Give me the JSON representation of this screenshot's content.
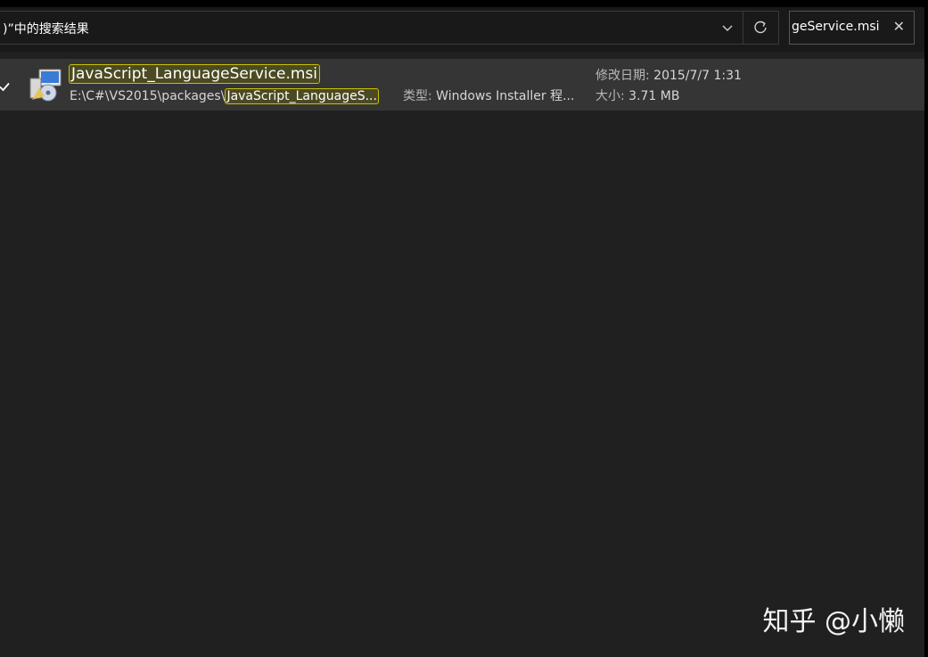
{
  "address": {
    "text": ")”中的搜索结果"
  },
  "search": {
    "value": "geService.msi"
  },
  "results": [
    {
      "name": "JavaScript_LanguageService.msi",
      "path_prefix": "E:\\C#\\VS2015\\packages\\",
      "path_highlight": "JavaScript_LanguageS...",
      "type_label": "类型:",
      "type_value": "Windows Installer 程...",
      "date_label": "修改日期:",
      "date_value": "2015/7/7 1:31",
      "size_label": "大小:",
      "size_value": "3.71 MB",
      "checked": true
    }
  ],
  "watermark": "知乎 @小懒",
  "colors": {
    "background": "#202020",
    "row_selected": "#353535",
    "highlight_border": "#c9c000"
  },
  "icons": {
    "dropdown": "chevron-down-icon",
    "refresh": "refresh-icon",
    "clear": "close-icon",
    "file": "msi-installer-icon",
    "checkbox": "checkmark-icon"
  }
}
